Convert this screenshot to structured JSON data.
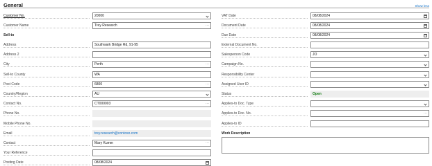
{
  "header": {
    "title": "General",
    "show_less": "Show less"
  },
  "left": {
    "customer_no": {
      "label": "Customer No.",
      "value": "20000"
    },
    "customer_name": {
      "label": "Customer Name",
      "value": "Trey Research"
    },
    "sell_to": "Sell-to",
    "address": {
      "label": "Address",
      "value": "Southwark Bridge Rd, 91-95"
    },
    "address2": {
      "label": "Address 2",
      "value": ""
    },
    "city": {
      "label": "City",
      "value": "Perth"
    },
    "county": {
      "label": "Sell-to County",
      "value": "WA"
    },
    "post_code": {
      "label": "Post Code",
      "value": "6800"
    },
    "country": {
      "label": "Country/Region",
      "value": "AU"
    },
    "contact_no": {
      "label": "Contact No.",
      "value": "CT000003"
    },
    "phone": {
      "label": "Phone No.",
      "value": ""
    },
    "mobile": {
      "label": "Mobile Phone No.",
      "value": ""
    },
    "email": {
      "label": "Email",
      "value": "trey.research@contoso.com"
    },
    "contact": {
      "label": "Contact",
      "value": "Mary Kumm"
    },
    "your_ref": {
      "label": "Your Reference",
      "value": ""
    },
    "posting_date": {
      "label": "Posting Date",
      "value": "08/08/2024"
    }
  },
  "right": {
    "vat_date": {
      "label": "VAT Date",
      "value": "08/08/2024"
    },
    "document_date": {
      "label": "Document Date",
      "value": "08/08/2024"
    },
    "due_date": {
      "label": "Due Date",
      "value": "08/08/2024"
    },
    "ext_doc_no": {
      "label": "External Document No.",
      "value": ""
    },
    "salesperson": {
      "label": "Salesperson Code",
      "value": "JO"
    },
    "campaign": {
      "label": "Campaign No.",
      "value": ""
    },
    "resp_center": {
      "label": "Responsibility Center",
      "value": ""
    },
    "assigned_user": {
      "label": "Assigned User ID",
      "value": ""
    },
    "status": {
      "label": "Status",
      "value": "Open"
    },
    "applies_type": {
      "label": "Applies-to Doc. Type",
      "value": ""
    },
    "applies_no": {
      "label": "Applies-to Doc. No.",
      "value": ""
    },
    "applies_id": {
      "label": "Applies-to ID",
      "value": ""
    },
    "work_desc": {
      "label": "Work Description",
      "value": ""
    }
  },
  "icons": {
    "lookup": "···"
  },
  "colors": {
    "link": "#0f6fc6",
    "status_open": "#107c10",
    "field_border": "#8a8a8a",
    "readonly_bg": "#eeeeee"
  }
}
